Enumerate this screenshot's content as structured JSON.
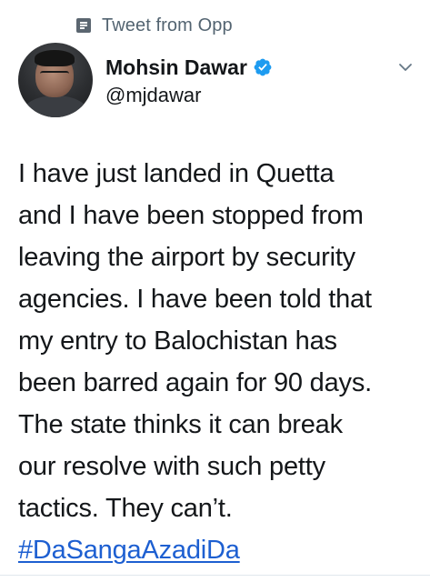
{
  "context": {
    "label": "Tweet from Opp",
    "icon": "document-icon"
  },
  "author": {
    "display_name": "Mohsin Dawar",
    "handle": "@mjdawar",
    "verified": true,
    "verified_color": "#1d9bf0"
  },
  "menu": {
    "icon": "chevron-down-icon"
  },
  "tweet": {
    "lines": [
      "I have just landed in Quetta",
      "and I have been stopped from",
      "leaving the airport by security",
      "agencies. I have been told that",
      "my entry to Balochistan has",
      "been barred again for 90 days.",
      "The state thinks it can break",
      "our resolve with such petty",
      "tactics. They can’t."
    ],
    "hashtag": "#DaSangaAzadiDa",
    "hashtag_color": "#1d5fd1"
  }
}
